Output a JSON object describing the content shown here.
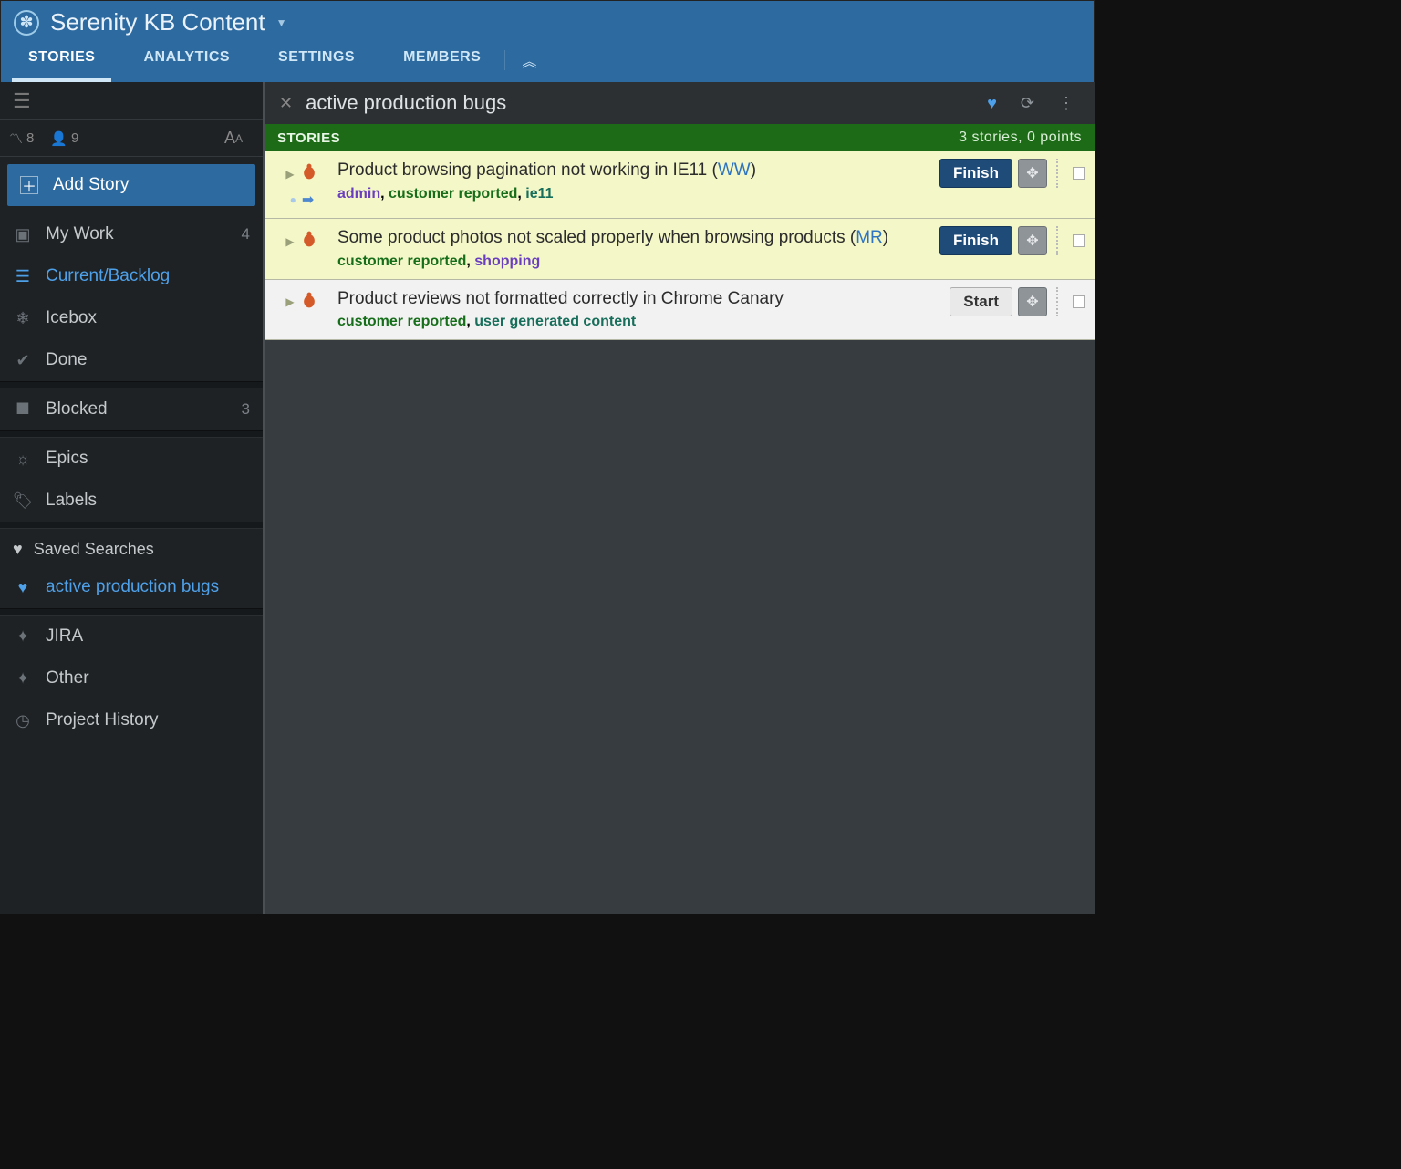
{
  "project_title": "Serenity KB Content",
  "tabs": {
    "stories": "STORIES",
    "analytics": "ANALYTICS",
    "settings": "SETTINGS",
    "members": "MEMBERS"
  },
  "sidebar": {
    "stat_velocity": "8",
    "stat_members": "9",
    "add_story": "Add Story",
    "items": {
      "my_work": {
        "label": "My Work",
        "count": "4"
      },
      "current_backlog": {
        "label": "Current/Backlog"
      },
      "icebox": {
        "label": "Icebox"
      },
      "done": {
        "label": "Done"
      },
      "blocked": {
        "label": "Blocked",
        "count": "3"
      },
      "epics": {
        "label": "Epics"
      },
      "labels": {
        "label": "Labels"
      },
      "saved_searches": {
        "label": "Saved Searches"
      },
      "active_prod_bugs": {
        "label": "active production bugs"
      },
      "jira": {
        "label": "JIRA"
      },
      "other": {
        "label": "Other"
      },
      "project_history": {
        "label": "Project History"
      }
    }
  },
  "panel": {
    "title": "active production bugs",
    "section_label": "STORIES",
    "meta": "3 stories, 0 points"
  },
  "stories": [
    {
      "title_prefix": "Product browsing pagination not working in IE11 (",
      "initials": "WW",
      "title_suffix": ")",
      "labels": [
        {
          "text": "admin",
          "cls": "lbl-purple"
        },
        {
          "text": ", ",
          "cls": ""
        },
        {
          "text": "customer reported",
          "cls": "lbl-green"
        },
        {
          "text": ", ",
          "cls": ""
        },
        {
          "text": "ie11",
          "cls": "lbl-teal"
        }
      ],
      "button": "Finish",
      "button_cls": "btn-finish",
      "row_cls": "started",
      "has_pointer": true
    },
    {
      "title_prefix": "Some product photos not scaled properly when browsing products (",
      "initials": "MR",
      "title_suffix": ")",
      "labels": [
        {
          "text": "customer reported",
          "cls": "lbl-green"
        },
        {
          "text": ", ",
          "cls": ""
        },
        {
          "text": "shopping",
          "cls": "lbl-purple"
        }
      ],
      "button": "Finish",
      "button_cls": "btn-finish",
      "row_cls": "started",
      "has_pointer": false
    },
    {
      "title_prefix": "Product reviews not formatted correctly in Chrome Canary",
      "initials": "",
      "title_suffix": "",
      "labels": [
        {
          "text": "customer reported",
          "cls": "lbl-green"
        },
        {
          "text": ", ",
          "cls": ""
        },
        {
          "text": "user generated content",
          "cls": "lbl-teal"
        }
      ],
      "button": "Start",
      "button_cls": "btn-start",
      "row_cls": "notstarted",
      "has_pointer": false
    }
  ]
}
